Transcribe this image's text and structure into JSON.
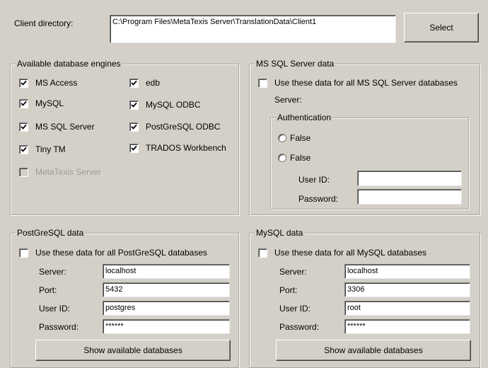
{
  "client": {
    "label": "Client directory:",
    "path": "C:\\Program Files\\MetaTexis Server\\TranslationData\\Client1",
    "select_button": "Select"
  },
  "engines": {
    "title": "Available database engines",
    "items": [
      {
        "label": "MS Access",
        "checked": true
      },
      {
        "label": "MySQL",
        "checked": true
      },
      {
        "label": "MS SQL Server",
        "checked": true
      },
      {
        "label": "Tiny TM",
        "checked": true
      },
      {
        "label": "MetaTexis Server",
        "checked": false,
        "disabled": true
      },
      {
        "label": "edb",
        "checked": true
      },
      {
        "label": "MySQL ODBC",
        "checked": true
      },
      {
        "label": "PostGreSQL ODBC",
        "checked": true
      },
      {
        "label": "TRADOS Workbench",
        "checked": true
      }
    ]
  },
  "mssql": {
    "title": "MS SQL Server data",
    "use_label": "Use these data for all MS SQL Server databases",
    "server_label": "Server:",
    "auth_title": "Authentication",
    "auth_option1": "False",
    "auth_option2": "False",
    "userid_label": "User ID:",
    "userid_value": "",
    "password_label": "Password:",
    "password_value": ""
  },
  "postgres": {
    "title": "PostGreSQL data",
    "use_label": "Use these data for all PostGreSQL databases",
    "server_label": "Server:",
    "server_value": "localhost",
    "port_label": "Port:",
    "port_value": "5432",
    "userid_label": "User ID:",
    "userid_value": "postgres",
    "password_label": "Password:",
    "password_value": "******",
    "show_button": "Show available databases"
  },
  "mysql": {
    "title": "MySQL data",
    "use_label": "Use these data for all MySQL databases",
    "server_label": "Server:",
    "server_value": "localhost",
    "port_label": "Port:",
    "port_value": "3306",
    "userid_label": "User ID:",
    "userid_value": "root",
    "password_label": "Password:",
    "password_value": "******",
    "show_button": "Show available databases"
  }
}
